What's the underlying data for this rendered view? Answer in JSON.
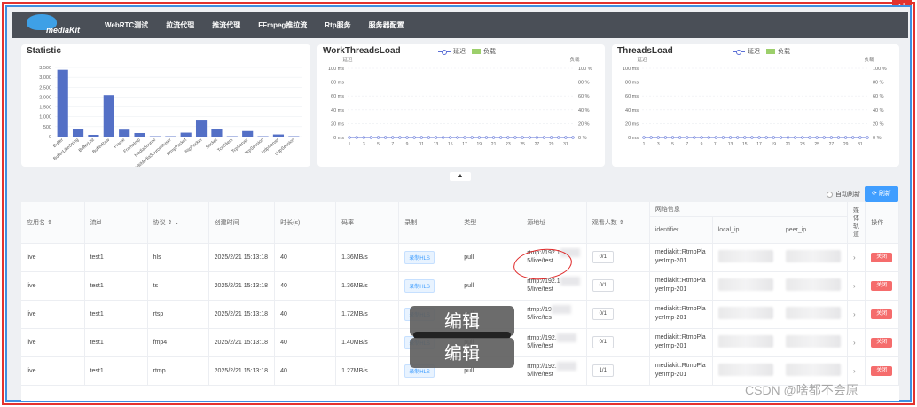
{
  "nav": {
    "logo_text": "mediaKit",
    "items": [
      "WebRTC测试",
      "拉流代理",
      "推流代理",
      "FFmpeg推拉流",
      "Rtp服务",
      "服务器配置"
    ]
  },
  "statistic": {
    "title": "Statistic",
    "chart_data": {
      "type": "bar",
      "title": "Statistic",
      "categories": [
        "Buffer",
        "BufferLikeString",
        "BufferList",
        "BufferRaw",
        "Frame",
        "FrameImp",
        "MediaSource",
        "MultiMediaSourceMuxer",
        "RtmpPacket",
        "RtpPacket",
        "Socket",
        "TcpClient",
        "TcpServer",
        "TcpSession",
        "UdpServer",
        "UdpSession"
      ],
      "values": [
        3380,
        370,
        90,
        2100,
        350,
        180,
        20,
        20,
        200,
        850,
        380,
        20,
        280,
        20,
        110,
        20
      ],
      "ylim": [
        0,
        3500
      ],
      "yticks": [
        0,
        500,
        1000,
        1500,
        2000,
        2500,
        3000,
        3500
      ],
      "color": "#5470c6"
    }
  },
  "work_threads": {
    "title": "WorkThreadsLoad",
    "legend": {
      "delay": "延迟",
      "load": "负载"
    },
    "left_unit": "延迟",
    "right_unit": "负载",
    "chart_data": {
      "type": "line",
      "x": [
        1,
        3,
        5,
        7,
        9,
        11,
        13,
        15,
        17,
        19,
        21,
        23,
        25,
        27,
        29,
        31
      ],
      "left_ticks": [
        "100 ms",
        "80 ms",
        "60 ms",
        "40 ms",
        "20 ms",
        "0 ms"
      ],
      "right_ticks": [
        "100 %",
        "80 %",
        "60 %",
        "40 %",
        "20 %",
        "0 %"
      ],
      "series": [
        {
          "name": "延迟",
          "values": [
            0,
            0,
            0,
            0,
            0,
            0,
            0,
            0,
            0,
            0,
            0,
            0,
            0,
            0,
            0,
            0,
            0,
            0,
            0,
            0,
            0,
            0,
            0,
            0,
            0,
            0,
            0,
            0,
            0,
            0,
            0,
            0
          ]
        }
      ],
      "ylim": [
        0,
        100
      ]
    }
  },
  "threads": {
    "title": "ThreadsLoad",
    "legend": {
      "delay": "延迟",
      "load": "负载"
    },
    "left_unit": "延迟",
    "right_unit": "负载",
    "chart_data": {
      "type": "line",
      "x": [
        1,
        3,
        5,
        7,
        9,
        11,
        13,
        15,
        17,
        19,
        21,
        23,
        25,
        27,
        29,
        31
      ],
      "left_ticks": [
        "100 ms",
        "80 ms",
        "60 ms",
        "40 ms",
        "20 ms",
        "0 ms"
      ],
      "right_ticks": [
        "100 %",
        "80 %",
        "60 %",
        "40 %",
        "20 %",
        "0 %"
      ],
      "series": [
        {
          "name": "延迟",
          "values": [
            0,
            0,
            0,
            0,
            0,
            0,
            0,
            0,
            0,
            0,
            0,
            0,
            0,
            0,
            0,
            0,
            0,
            0,
            0,
            0,
            0,
            0,
            0,
            0,
            0,
            0,
            0,
            0,
            0,
            0,
            0,
            0
          ]
        }
      ],
      "ylim": [
        0,
        100
      ]
    }
  },
  "toolbar": {
    "expand_label": "▲",
    "auto_refresh": "自动刷新",
    "refresh": "刷新"
  },
  "table": {
    "headers": {
      "app": "应用名 ⇕",
      "stream": "流id",
      "schema": "协议 ⇕ ⌄",
      "created": "创建时间",
      "duration": "时长(s)",
      "bitrate": "码率",
      "record": "录制",
      "type": "类型",
      "origin": "源地址",
      "readers": "观看人数 ⇕",
      "network": "网络信息",
      "identifier": "identifier",
      "local_ip": "local_ip",
      "peer_ip": "peer_ip",
      "tracks": "媒体轨道",
      "ops": "操作"
    },
    "rows": [
      {
        "app": "live",
        "stream": "test1",
        "schema": "hls",
        "created": "2025/2/21 15:13:18",
        "duration": "40",
        "bitrate": "1.36MB/s",
        "record": "录制HLS",
        "type": "pull",
        "origin_a": "rtmp://192.1",
        "origin_b": "5/live/test",
        "readers": "0/1",
        "ident_a": "mediakit::RtmpPla",
        "ident_b": "yerImp-201",
        "close": "关闭"
      },
      {
        "app": "live",
        "stream": "test1",
        "schema": "ts",
        "created": "2025/2/21 15:13:18",
        "duration": "40",
        "bitrate": "1.36MB/s",
        "record": "录制HLS",
        "type": "pull",
        "origin_a": "rtmp://192.1",
        "origin_b": "5/live/test",
        "readers": "0/1",
        "ident_a": "mediakit::RtmpPla",
        "ident_b": "yerImp-201",
        "close": "关闭"
      },
      {
        "app": "live",
        "stream": "test1",
        "schema": "rtsp",
        "created": "2025/2/21 15:13:18",
        "duration": "40",
        "bitrate": "1.72MB/s",
        "record": "录制HLS",
        "type": "pull",
        "origin_a": "rtmp://19",
        "origin_b": "5/live/tes",
        "readers": "0/1",
        "ident_a": "mediakit::RtmpPla",
        "ident_b": "yerImp-201",
        "close": "关闭"
      },
      {
        "app": "live",
        "stream": "test1",
        "schema": "fmp4",
        "created": "2025/2/21 15:13:18",
        "duration": "40",
        "bitrate": "1.40MB/s",
        "record": "录制HLS",
        "type": "pull",
        "origin_a": "rtmp://192.",
        "origin_b": "5/live/test",
        "readers": "0/1",
        "ident_a": "mediakit::RtmpPla",
        "ident_b": "yerImp-201",
        "close": "关闭"
      },
      {
        "app": "live",
        "stream": "test1",
        "schema": "rtmp",
        "created": "2025/2/21 15:13:18",
        "duration": "40",
        "bitrate": "1.27MB/s",
        "record": "录制HLS",
        "type": "pull",
        "origin_a": "rtmp://192.",
        "origin_b": "5/live/test",
        "readers": "1/1",
        "ident_a": "mediakit::RtmpPla",
        "ident_b": "yerImp-201",
        "close": "关闭"
      }
    ]
  },
  "overlay": {
    "tooltip_1": "编辑",
    "tooltip_2": "编辑"
  },
  "watermark": "CSDN @啥都不会原",
  "corner_badge": "↵"
}
